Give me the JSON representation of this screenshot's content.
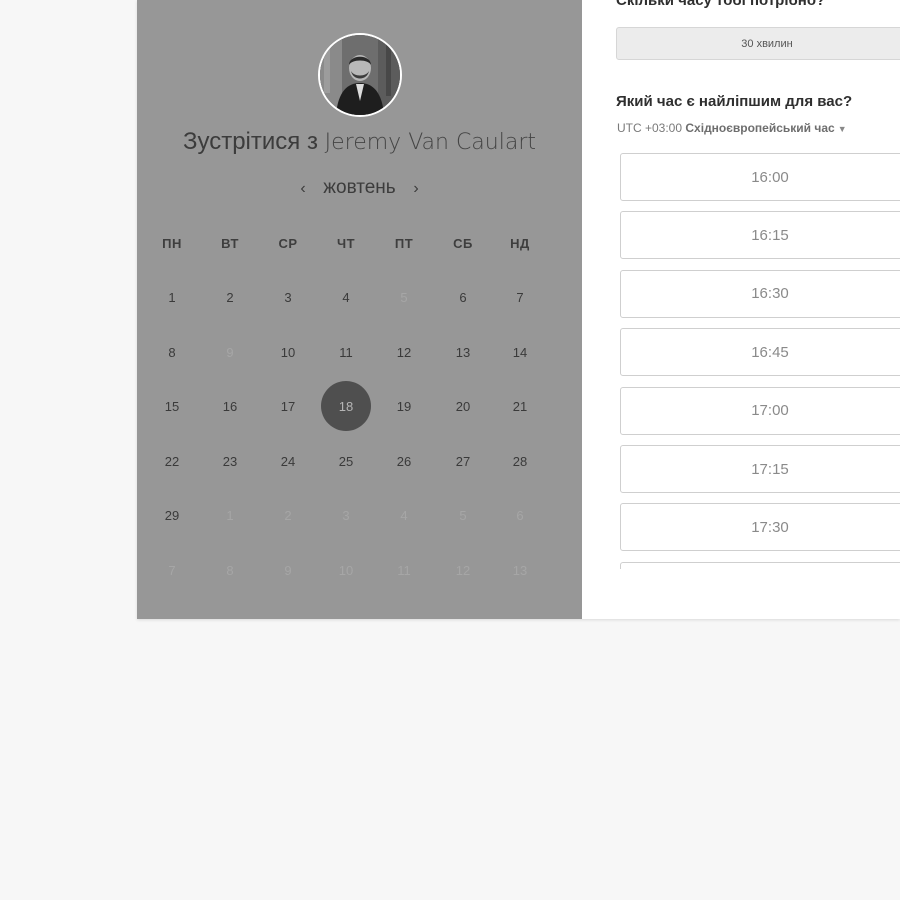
{
  "booking": {
    "title_prefix": "Зустрітися з",
    "host_name": "Jeremy Van Caulart",
    "month_label": "жовтень",
    "prev_arrow": "‹",
    "next_arrow": "›"
  },
  "calendar": {
    "weekdays": [
      "ПН",
      "ВТ",
      "СР",
      "ЧТ",
      "ПТ",
      "СБ",
      "НД"
    ],
    "weeks": [
      [
        {
          "d": "1",
          "f": false
        },
        {
          "d": "2",
          "f": false
        },
        {
          "d": "3",
          "f": false
        },
        {
          "d": "4",
          "f": false
        },
        {
          "d": "5",
          "f": true
        },
        {
          "d": "6",
          "f": false
        },
        {
          "d": "7",
          "f": false
        }
      ],
      [
        {
          "d": "8",
          "f": false
        },
        {
          "d": "9",
          "f": true
        },
        {
          "d": "10",
          "f": false
        },
        {
          "d": "11",
          "f": false
        },
        {
          "d": "12",
          "f": false
        },
        {
          "d": "13",
          "f": false
        },
        {
          "d": "14",
          "f": false
        }
      ],
      [
        {
          "d": "15",
          "f": false
        },
        {
          "d": "16",
          "f": false
        },
        {
          "d": "17",
          "f": false
        },
        {
          "d": "18",
          "f": false,
          "s": true
        },
        {
          "d": "19",
          "f": false
        },
        {
          "d": "20",
          "f": false
        },
        {
          "d": "21",
          "f": false
        }
      ],
      [
        {
          "d": "22",
          "f": false
        },
        {
          "d": "23",
          "f": false
        },
        {
          "d": "24",
          "f": false
        },
        {
          "d": "25",
          "f": false
        },
        {
          "d": "26",
          "f": false
        },
        {
          "d": "27",
          "f": false
        },
        {
          "d": "28",
          "f": false
        }
      ],
      [
        {
          "d": "29",
          "f": false
        },
        {
          "d": "1",
          "f": true
        },
        {
          "d": "2",
          "f": true
        },
        {
          "d": "3",
          "f": true
        },
        {
          "d": "4",
          "f": true
        },
        {
          "d": "5",
          "f": true
        },
        {
          "d": "6",
          "f": true
        }
      ],
      [
        {
          "d": "7",
          "f": true
        },
        {
          "d": "8",
          "f": true
        },
        {
          "d": "9",
          "f": true
        },
        {
          "d": "10",
          "f": true
        },
        {
          "d": "11",
          "f": true
        },
        {
          "d": "12",
          "f": true
        },
        {
          "d": "13",
          "f": true
        }
      ]
    ]
  },
  "scheduler": {
    "duration_question": "Скільки часу тобі потрібно?",
    "duration_value": "30 хвилин",
    "time_question": "Який час є найліпшим для вас?",
    "tz_offset": "UTC +03:00",
    "tz_name": "Східноєвропейський час",
    "tz_caret": "▼",
    "slots": [
      "16:00",
      "16:15",
      "16:30",
      "16:45",
      "17:00",
      "17:15",
      "17:30",
      ""
    ]
  },
  "colors": {
    "panel_overlay": "#979797",
    "selected_day": "#4f4f4f",
    "page_bg": "#f7f7f7"
  }
}
